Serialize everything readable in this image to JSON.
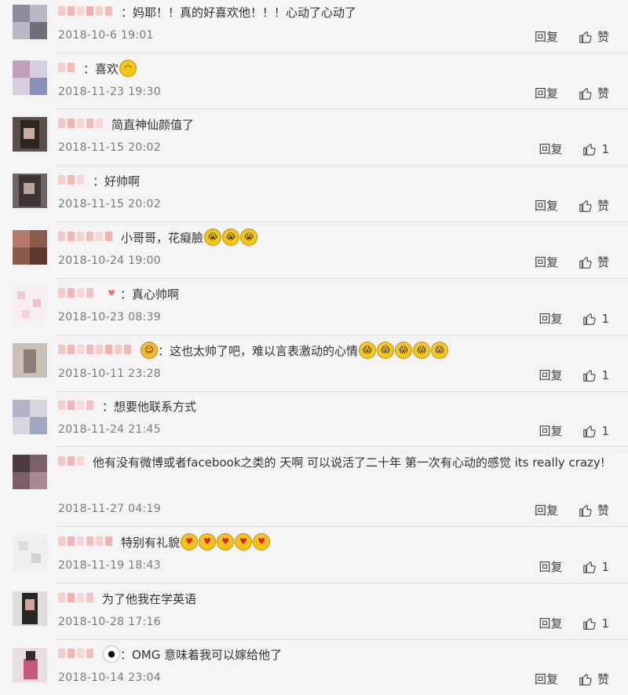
{
  "comments": [
    {
      "text": "：妈耶！！真的好喜欢他！！！心动了心动了",
      "emojis": [],
      "time": "2018-10-6 19:01",
      "reply": "回复",
      "like": "赞"
    },
    {
      "text": "：喜欢",
      "emojis": [
        "smile"
      ],
      "time": "2018-11-23 19:30",
      "reply": "回复",
      "like": "赞"
    },
    {
      "text": "简直神仙颜值了",
      "emojis": [],
      "time": "2018-11-15 20:02",
      "reply": "回复",
      "like": "1"
    },
    {
      "text": "：好帅啊",
      "emojis": [],
      "time": "2018-11-15 20:02",
      "reply": "回复",
      "like": "赞"
    },
    {
      "text": "小哥哥，花癡臉",
      "emojis": [
        "cry",
        "cry",
        "cry"
      ],
      "time": "2018-10-24 19:00",
      "reply": "回复",
      "like": "赞"
    },
    {
      "text": "：真心帅啊",
      "emojis": [],
      "time": "2018-10-23 08:39",
      "reply": "回复",
      "like": "1"
    },
    {
      "text": "：这也太帅了吧，难以言表激动的心情",
      "emojis": [
        "shock",
        "shock",
        "shock",
        "shock",
        "shock"
      ],
      "time": "2018-10-11 23:28",
      "reply": "回复",
      "like": "1"
    },
    {
      "text": "：想要他联系方式",
      "emojis": [],
      "time": "2018-11-24 21:45",
      "reply": "回复",
      "like": "1"
    },
    {
      "text": "他有没有微博或者facebook之类的 天啊 可以说活了二十年 第一次有心动的感觉 its really crazy!",
      "emojis": [],
      "time": "2018-11-27 04:19",
      "reply": "回复",
      "like": "赞"
    },
    {
      "text": "特别有礼貌",
      "emojis": [
        "heart",
        "heart",
        "heart",
        "heart",
        "heart"
      ],
      "time": "2018-11-19 18:43",
      "reply": "回复",
      "like": "1"
    },
    {
      "text": "为了他我在学英语",
      "emojis": [],
      "time": "2018-10-28 17:16",
      "reply": "回复",
      "like": "1"
    },
    {
      "text": "：OMG 意味着我可以嫁给他了",
      "emojis": [],
      "time": "2018-10-14 23:04",
      "reply": "回复",
      "like": "赞"
    }
  ],
  "colors": {
    "background": "#f4f4f4",
    "text": "#333333",
    "meta": "#7a7a7a"
  },
  "icons": {
    "like": "thumbs-up-icon"
  }
}
